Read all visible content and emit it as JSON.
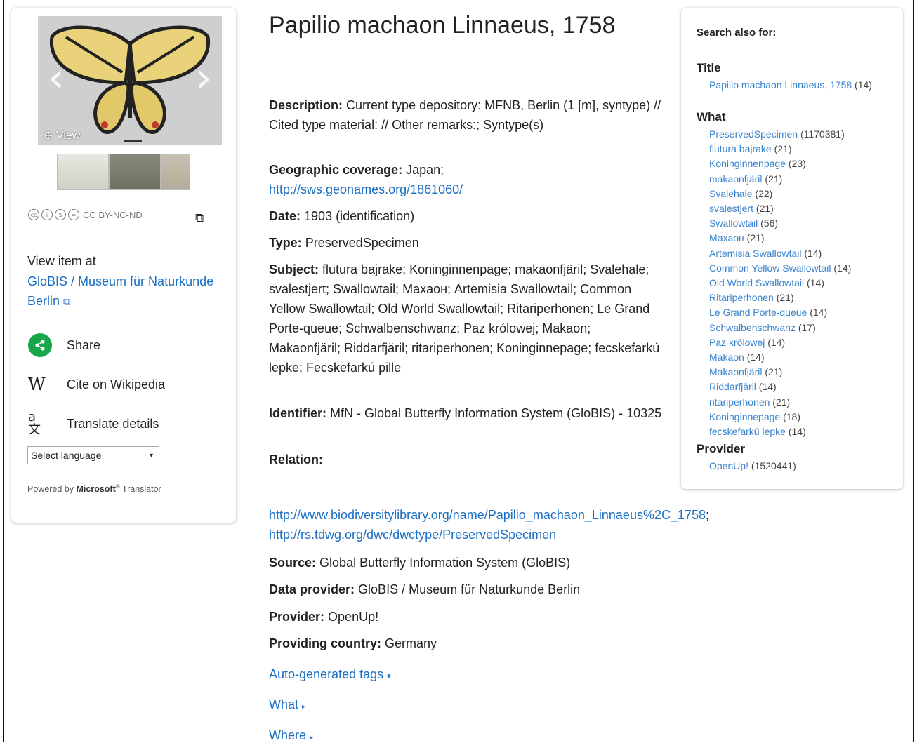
{
  "record": {
    "title": "Papilio machaon Linnaeus, 1758",
    "carousel": {
      "view_label": "View"
    },
    "license": {
      "label": "CC BY-NC-ND",
      "icons": [
        "cc-icon",
        "by-icon",
        "nc-icon",
        "nd-icon"
      ]
    },
    "view_item": {
      "label": "View item at",
      "link": "GloBIS / Museum für Naturkunde Berlin"
    },
    "actions": {
      "share": "Share",
      "cite": "Cite on Wikipedia",
      "translate": "Translate details"
    },
    "language_select": {
      "selected": "Select language"
    },
    "powered_by": {
      "prefix": "Powered by",
      "brand": "Microsoft",
      "suffix": "Translator"
    }
  },
  "fields": {
    "description": {
      "label": "Description:",
      "value": "Current type depository: MFNB, Berlin (1 [m], syntype) // Cited type material: // Other remarks:; Syntype(s)"
    },
    "geographic": {
      "label": "Geographic coverage:",
      "value": "Japan;",
      "link": "http://sws.geonames.org/1861060/"
    },
    "date": {
      "label": "Date:",
      "value": "1903 (identification)"
    },
    "type": {
      "label": "Type:",
      "value": "PreservedSpecimen"
    },
    "subject": {
      "label": "Subject:",
      "value": "flutura bajrake; Koninginnenpage; makaonfjäril; Svalehale; svalestjert; Swallowtail; Махаон; Artemisia Swallowtail; Common Yellow Swallowtail; Old World Swallowtail; Ritariperhonen; Le Grand Porte-queue; Schwalbenschwanz; Paz królowej; Makaon; Makaonfjäril; Riddarfjäril; ritariperhonen; Koninginnepage; fecskefarkú lepke; Fecskefarkú pille"
    },
    "identifier": {
      "label": "Identifier:",
      "value": "MfN - Global Butterfly Information System (GloBIS) - 10325"
    },
    "relation": {
      "label": "Relation:",
      "link1": "http://www.biodiversitylibrary.org/name/Papilio_machaon_Linnaeus%2C_1758",
      "sep": ";",
      "link2": "http://rs.tdwg.org/dwc/dwctype/PreservedSpecimen"
    },
    "source": {
      "label": "Source:",
      "value": "Global Butterfly Information System (GloBIS)"
    },
    "data_provider": {
      "label": "Data provider:",
      "value": "GloBIS / Museum für Naturkunde Berlin"
    },
    "provider": {
      "label": "Provider:",
      "value": "OpenUp!"
    },
    "country": {
      "label": "Providing country:",
      "value": "Germany"
    }
  },
  "toggles": {
    "auto_tags": "Auto-generated tags",
    "what": "What",
    "where": "Where"
  },
  "search_also": {
    "heading": "Search also for:",
    "title_group": {
      "title": "Title",
      "items": [
        {
          "label": "Papilio machaon Linnaeus, 1758",
          "count": "(14)"
        }
      ]
    },
    "what_group": {
      "title": "What",
      "items": [
        {
          "label": "PreservedSpecimen",
          "count": "(1170381)"
        },
        {
          "label": "flutura bajrake",
          "count": "(21)"
        },
        {
          "label": "Koninginnenpage",
          "count": "(23)"
        },
        {
          "label": "makaonfjäril",
          "count": "(21)"
        },
        {
          "label": "Svalehale",
          "count": "(22)"
        },
        {
          "label": "svalestjert",
          "count": "(21)"
        },
        {
          "label": "Swallowtail",
          "count": "(56)"
        },
        {
          "label": "Махаон",
          "count": "(21)"
        },
        {
          "label": "Artemisia Swallowtail",
          "count": "(14)"
        },
        {
          "label": "Common Yellow Swallowtail",
          "count": "(14)"
        },
        {
          "label": "Old World Swallowtail",
          "count": "(14)"
        },
        {
          "label": "Ritariperhonen",
          "count": "(21)"
        },
        {
          "label": "Le Grand Porte-queue",
          "count": "(14)"
        },
        {
          "label": "Schwalbenschwanz",
          "count": "(17)"
        },
        {
          "label": "Paz królowej",
          "count": "(14)"
        },
        {
          "label": "Makaon",
          "count": "(14)"
        },
        {
          "label": "Makaonfjäril",
          "count": "(21)"
        },
        {
          "label": "Riddarfjäril",
          "count": "(14)"
        },
        {
          "label": "ritariperhonen",
          "count": "(21)"
        },
        {
          "label": "Koninginnepage",
          "count": "(18)"
        },
        {
          "label": "fecskefarkú lepke",
          "count": "(14)"
        }
      ]
    },
    "provider_group": {
      "title": "Provider",
      "items": [
        {
          "label": "OpenUp!",
          "count": "(1520441)"
        }
      ]
    }
  },
  "colors": {
    "link": "#1a6fc4",
    "share_green": "#18a64a"
  }
}
